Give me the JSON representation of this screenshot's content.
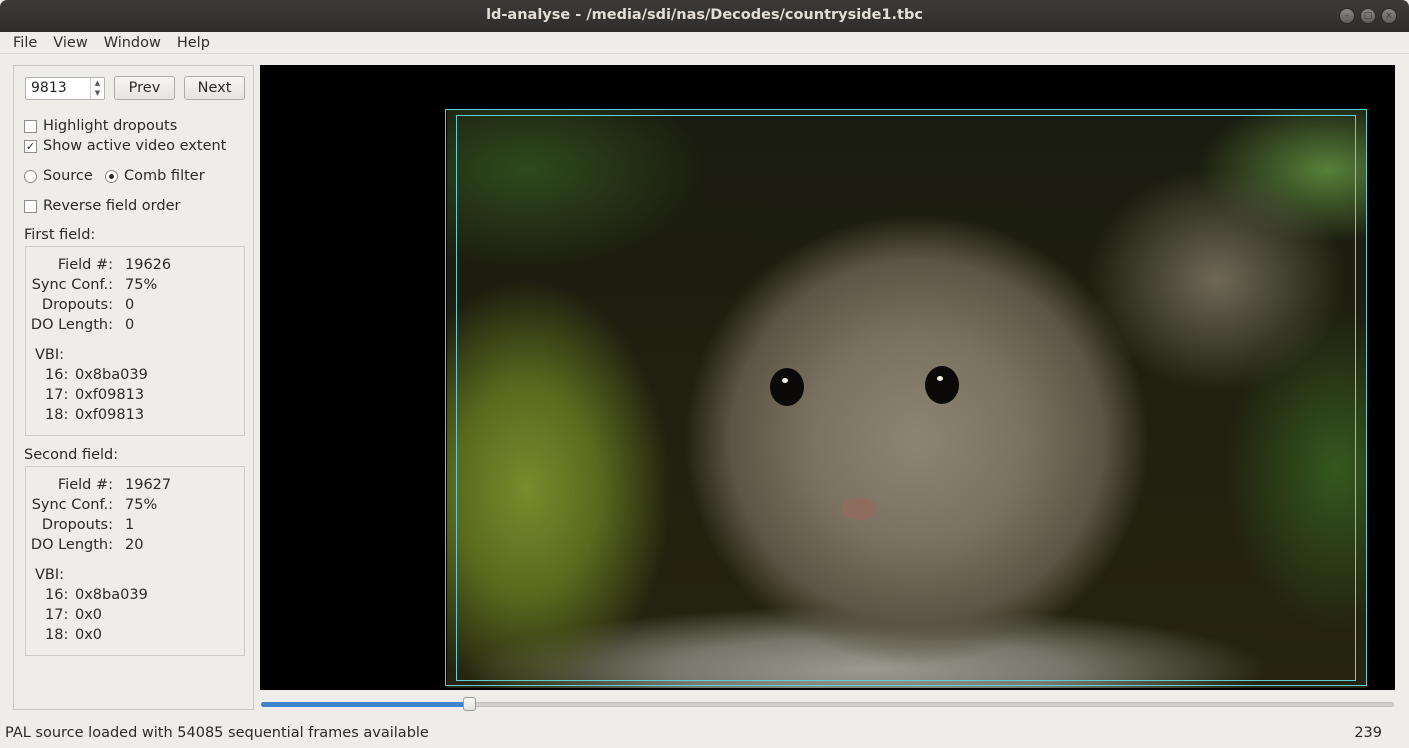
{
  "window": {
    "title": "ld-analyse - /media/sdi/nas/Decodes/countryside1.tbc",
    "controls": [
      "minimize-icon",
      "maximize-icon",
      "close-icon"
    ]
  },
  "menu": [
    "File",
    "View",
    "Window",
    "Help"
  ],
  "controls": {
    "frame_number": "9813",
    "prev_label": "Prev",
    "next_label": "Next",
    "highlight_dropouts": {
      "label": "Highlight dropouts",
      "checked": false
    },
    "show_active_video": {
      "label": "Show active video extent",
      "checked": true
    },
    "source_radio": {
      "label": "Source",
      "selected": false
    },
    "comb_radio": {
      "label": "Comb filter",
      "selected": true
    },
    "reverse_field": {
      "label": "Reverse field order",
      "checked": false
    }
  },
  "first_field": {
    "heading": "First field:",
    "rows": [
      {
        "key": "Field #:",
        "value": "19626"
      },
      {
        "key": "Sync Conf.:",
        "value": "75%"
      },
      {
        "key": "Dropouts:",
        "value": "0"
      },
      {
        "key": "DO Length:",
        "value": "0"
      }
    ],
    "vbi_label": "VBI:",
    "vbi": [
      {
        "line": "16:",
        "hex": "0x8ba039"
      },
      {
        "line": "17:",
        "hex": "0xf09813"
      },
      {
        "line": "18:",
        "hex": "0xf09813"
      }
    ]
  },
  "second_field": {
    "heading": "Second field:",
    "rows": [
      {
        "key": "Field #:",
        "value": "19627"
      },
      {
        "key": "Sync Conf.:",
        "value": "75%"
      },
      {
        "key": "Dropouts:",
        "value": "1"
      },
      {
        "key": "DO Length:",
        "value": "20"
      }
    ],
    "vbi_label": "VBI:",
    "vbi": [
      {
        "line": "16:",
        "hex": "0x8ba039"
      },
      {
        "line": "17:",
        "hex": "0x0"
      },
      {
        "line": "18:",
        "hex": "0x0"
      }
    ]
  },
  "slider": {
    "position_fraction": 0.18
  },
  "status": {
    "message": "PAL source loaded with 54085 sequential frames available",
    "value": "239"
  },
  "colors": {
    "accent": "#3f85cd",
    "extent_outline": "#5fd0d8",
    "titlebar": "#3c3b37"
  }
}
